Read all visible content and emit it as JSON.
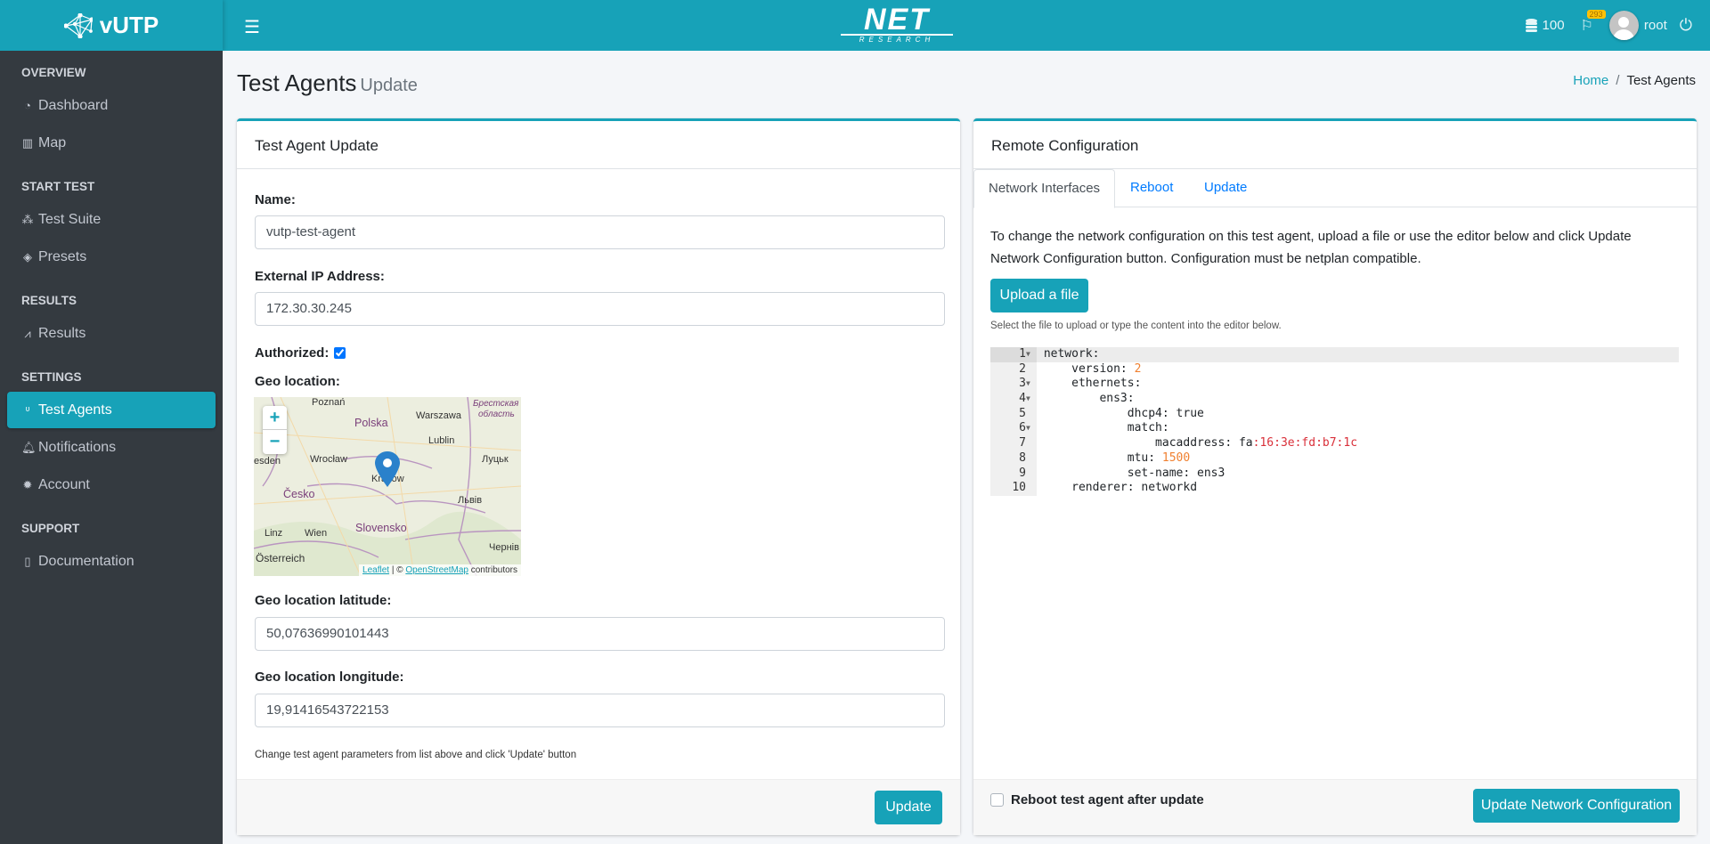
{
  "brand": {
    "name": "vUTP",
    "logo_text": "NET",
    "logo_sub": "RESEARCH"
  },
  "topbar": {
    "db_count": "100",
    "flag_badge": "293",
    "user": "root"
  },
  "sidebar": {
    "sections": [
      {
        "title": "OVERVIEW",
        "items": [
          {
            "label": "Dashboard",
            "icon": "tachometer-icon"
          },
          {
            "label": "Map",
            "icon": "map-icon"
          }
        ]
      },
      {
        "title": "START TEST",
        "items": [
          {
            "label": "Test Suite",
            "icon": "cubes-icon"
          },
          {
            "label": "Presets",
            "icon": "cube-icon"
          }
        ]
      },
      {
        "title": "RESULTS",
        "items": [
          {
            "label": "Results",
            "icon": "chart-line-icon"
          }
        ]
      },
      {
        "title": "SETTINGS",
        "items": [
          {
            "label": "Test Agents",
            "icon": "stethoscope-icon",
            "active": true
          },
          {
            "label": "Notifications",
            "icon": "bell-icon"
          },
          {
            "label": "Account",
            "icon": "cog-icon"
          }
        ]
      },
      {
        "title": "SUPPORT",
        "items": [
          {
            "label": "Documentation",
            "icon": "file-icon"
          }
        ]
      }
    ]
  },
  "page": {
    "title": "Test Agents",
    "subtitle": "Update",
    "breadcrumb": [
      "Home",
      "Test Agents"
    ]
  },
  "left": {
    "title": "Test Agent Update",
    "name_label": "Name:",
    "name_value": "vutp-test-agent",
    "ip_label": "External IP Address:",
    "ip_value": "172.30.30.245",
    "authorized_label": "Authorized:",
    "authorized": true,
    "geo_label": "Geo location:",
    "map": {
      "labels": [
        "Poznań",
        "Polska",
        "Warszawa",
        "Брестская",
        "область",
        "Lublin",
        "esden",
        "Wrocław",
        "Kraków",
        "Луцьк",
        "Česko",
        "Львів",
        "Slovensko",
        "Linz",
        "Wien",
        "Österreich",
        "Чернів"
      ],
      "attribution_leaflet": "Leaflet",
      "attribution_sep": "| ©",
      "attribution_osm": "OpenStreetMap",
      "attribution_tail": "contributors",
      "zoom_in": "+",
      "zoom_out": "−"
    },
    "lat_label": "Geo location latitude:",
    "lat_value": "50,07636990101443",
    "lon_label": "Geo location longitude:",
    "lon_value": "19,91416543722153",
    "help": "Change test agent parameters from list above and click 'Update' button",
    "update_button": "Update"
  },
  "right": {
    "title": "Remote Configuration",
    "tabs": [
      "Network Interfaces",
      "Reboot",
      "Update"
    ],
    "description": "To change the network configuration on this test agent, upload a file or use the editor below and click Update Network Configuration button. Configuration must be netplan compatible.",
    "upload_button": "Upload a file",
    "upload_help": "Select the file to upload or type the content into the editor below.",
    "code": [
      {
        "n": "1",
        "k": "network:",
        "v": ""
      },
      {
        "n": "2",
        "k": "    version: ",
        "v": "2"
      },
      {
        "n": "3",
        "k": "    ethernets:",
        "v": ""
      },
      {
        "n": "4",
        "k": "        ens3:",
        "v": ""
      },
      {
        "n": "5",
        "k": "            dhcp4: true",
        "v": ""
      },
      {
        "n": "6",
        "k": "            match:",
        "v": ""
      },
      {
        "n": "7",
        "k": "                macaddress: fa",
        "v": ":16:3e:fd:b7:1c"
      },
      {
        "n": "8",
        "k": "            mtu: ",
        "v": "1500"
      },
      {
        "n": "9",
        "k": "            set-name: ens3",
        "v": ""
      },
      {
        "n": "10",
        "k": "    renderer: networkd",
        "v": ""
      }
    ],
    "reboot_label": "Reboot test agent after update",
    "reboot_checked": false,
    "update_network_button": "Update Network Configuration"
  },
  "colors": {
    "accent": "#17a2b8",
    "sidebar": "#343a40",
    "link": "#007bff"
  }
}
